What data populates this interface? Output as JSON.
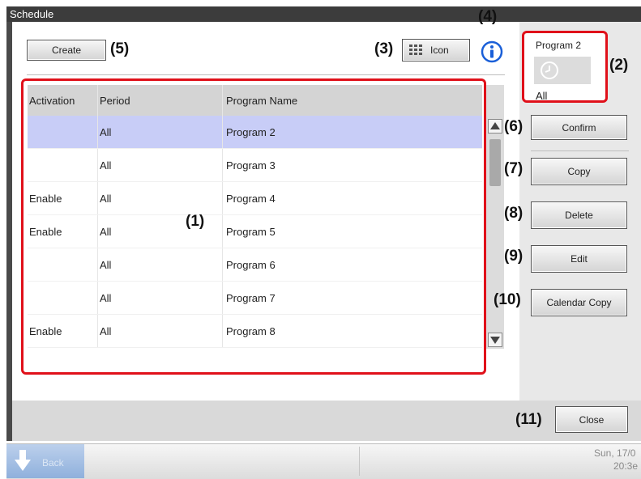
{
  "window": {
    "title": "Schedule"
  },
  "toolbar": {
    "create_label": "Create",
    "icon_label": "Icon"
  },
  "table": {
    "columns": [
      "Activation",
      "Period",
      "Program Name"
    ],
    "rows": [
      {
        "activation": "",
        "period": "All",
        "name": "Program 2",
        "selected": true
      },
      {
        "activation": "",
        "period": "All",
        "name": "Program 3",
        "selected": false
      },
      {
        "activation": "Enable",
        "period": "All",
        "name": "Program 4",
        "selected": false
      },
      {
        "activation": "Enable",
        "period": "All",
        "name": "Program 5",
        "selected": false
      },
      {
        "activation": "",
        "period": "All",
        "name": "Program 6",
        "selected": false
      },
      {
        "activation": "",
        "period": "All",
        "name": "Program 7",
        "selected": false
      },
      {
        "activation": "Enable",
        "period": "All",
        "name": "Program 8",
        "selected": false
      }
    ]
  },
  "preview": {
    "name": "Program 2",
    "period": "All"
  },
  "side_buttons": {
    "confirm": "Confirm",
    "copy": "Copy",
    "delete": "Delete",
    "edit": "Edit",
    "calendar_copy": "Calendar Copy"
  },
  "footer": {
    "close_label": "Close"
  },
  "taskbar": {
    "back_label": "Back",
    "date": "Sun, 17/0",
    "time": "20:3e"
  },
  "callouts": [
    "(1)",
    "(2)",
    "(3)",
    "(4)",
    "(5)",
    "(6)",
    "(7)",
    "(8)",
    "(9)",
    "(10)",
    "(11)"
  ],
  "colors": {
    "selection": "#c8cdf7",
    "callout_box": "#e0101a",
    "info_icon": "#1a5fd8"
  }
}
